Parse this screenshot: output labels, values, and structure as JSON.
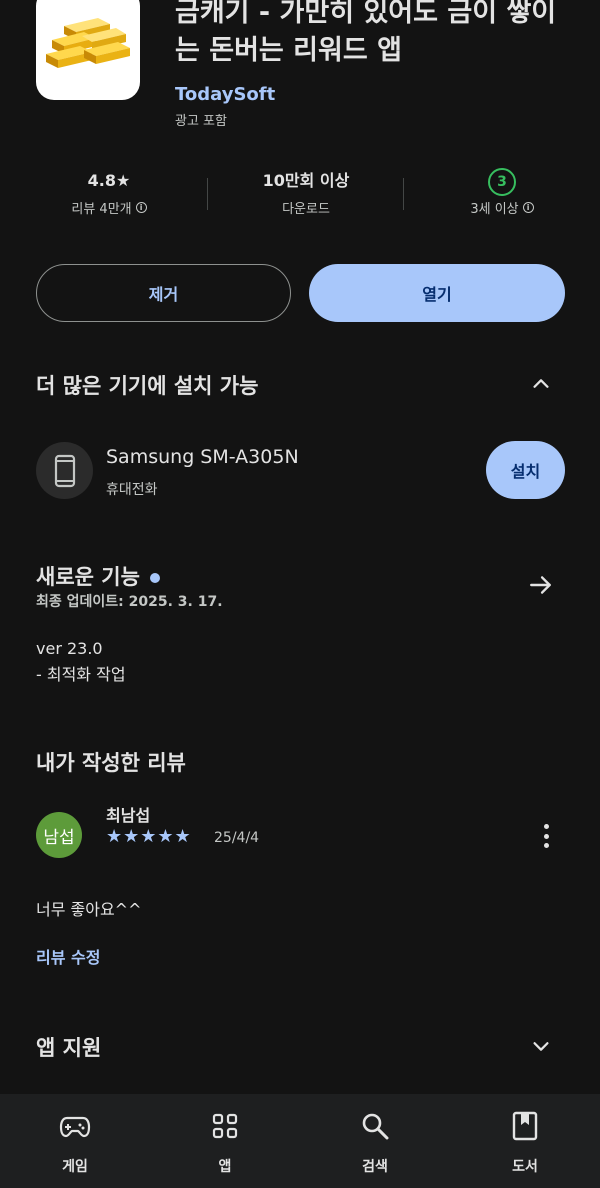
{
  "app": {
    "title": "금캐기 - 가만히 있어도 금이 쌓이는 돈버는 리워드 앱",
    "developer": "TodaySoft",
    "ads_label": "광고 포함",
    "icon": "gold-bars-icon"
  },
  "stats": {
    "rating": "4.8★",
    "reviews": "리뷰 4만개",
    "downloads": "10만회 이상",
    "downloads_label": "다운로드",
    "age_badge": "3",
    "age_label": "3세 이상"
  },
  "actions": {
    "uninstall": "제거",
    "open": "열기"
  },
  "more_devices": {
    "title": "더 많은 기기에 설치 가능",
    "device_name": "Samsung SM-A305N",
    "device_type": "휴대전화",
    "install": "설치"
  },
  "whats_new": {
    "title": "새로운 기능",
    "updated": "최종 업데이트: 2025. 3. 17.",
    "line1": "ver 23.0",
    "line2": "- 최적화 작업"
  },
  "my_review": {
    "title": "내가 작성한 리뷰",
    "avatar_text": "남섭",
    "reviewer": "최남섭",
    "stars": 5,
    "stars_text": "★★★★★",
    "date": "25/4/4",
    "text": "너무 좋아요^^",
    "edit": "리뷰 수정"
  },
  "app_support": {
    "title": "앱 지원"
  },
  "nav": [
    {
      "label": "게임",
      "icon": "gamepad-icon"
    },
    {
      "label": "앱",
      "icon": "apps-grid-icon"
    },
    {
      "label": "검색",
      "icon": "search-icon"
    },
    {
      "label": "도서",
      "icon": "book-icon"
    }
  ],
  "colors": {
    "background": "#131313",
    "accent": "#a8c7fa",
    "age_green": "#37be5f",
    "avatar": "#5d9b3a"
  }
}
